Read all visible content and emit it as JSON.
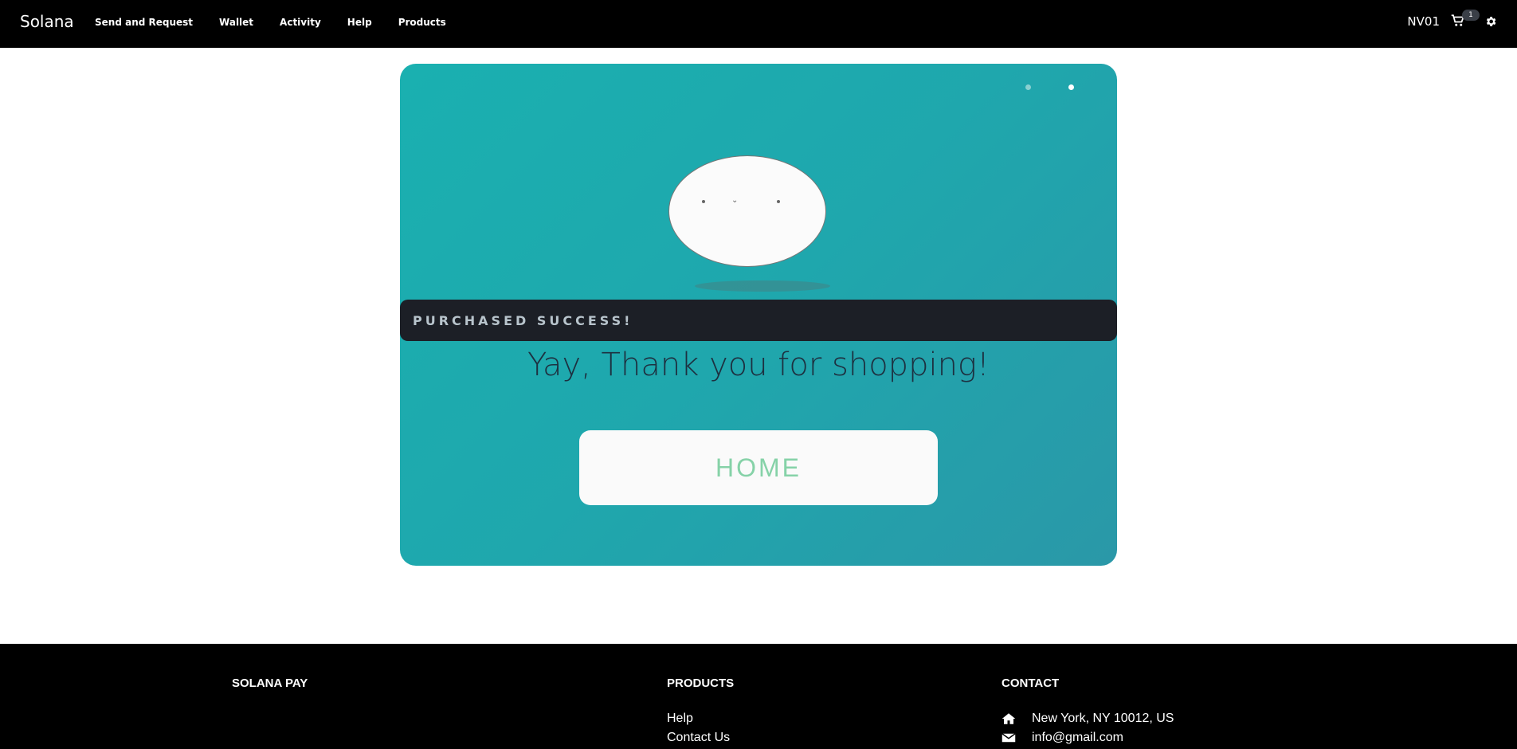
{
  "navbar": {
    "brand": "Solana",
    "links": [
      "Send and Request",
      "Wallet",
      "Activity",
      "Help",
      "Products"
    ],
    "user": "NV01",
    "cart_count": "1"
  },
  "card": {
    "banner": "PURCHASED SUCCESS!",
    "message": "Yay, Thank you for shopping!",
    "home_button": "HOME"
  },
  "footer": {
    "brand_title": "SOLANA PAY",
    "products_title": "PRODUCTS",
    "products_links": [
      "Help",
      "Contact Us"
    ],
    "contact_title": "CONTACT",
    "address": "New York, NY 10012, US",
    "email": "info@gmail.com"
  },
  "colors": {
    "nav_bg": "#000000",
    "card_teal": "#1ab0b0",
    "banner_bg": "#1c1f26",
    "home_text": "#86d2a8"
  },
  "icons": [
    "cart-icon",
    "gear-icon",
    "home-icon",
    "envelope-icon"
  ]
}
